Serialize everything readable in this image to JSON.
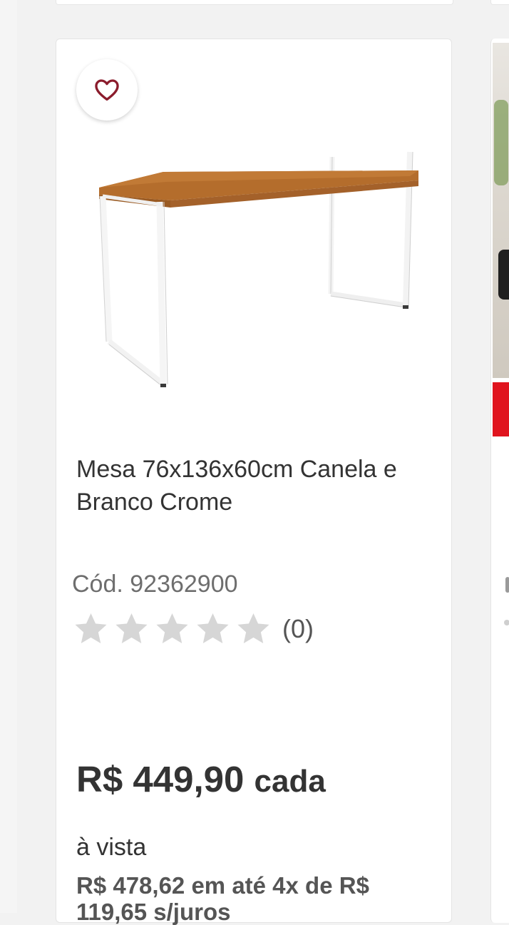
{
  "favorite": {
    "icon": "heart-icon",
    "color": "#8b1c2c"
  },
  "product": {
    "title": "Mesa 76x136x60cm Canela e Branco Crome",
    "sku": "Cód. 92362900",
    "rating": {
      "stars": 0,
      "max": 5,
      "count_label": "(0)",
      "star_color": "#d6d6d6"
    },
    "price": {
      "main": "R$ 449,90",
      "unit": "cada",
      "payment_note": "à vista",
      "installments": "R$ 478,62 em até 4x de R$ 119,65 s/juros"
    }
  },
  "colors": {
    "text_primary": "#333333",
    "text_secondary": "#6e6e6e",
    "accent_red": "#e0141e"
  }
}
